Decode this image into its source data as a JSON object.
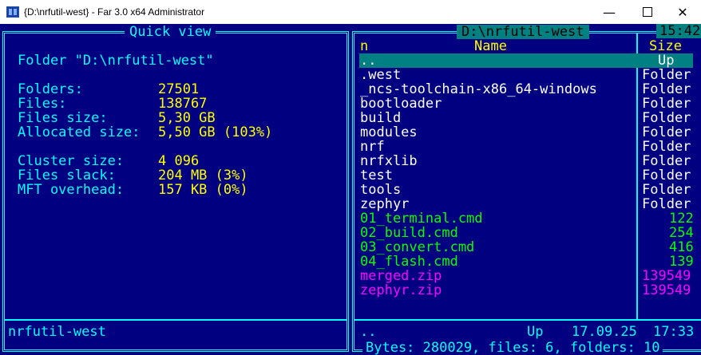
{
  "window": {
    "title": "{D:\\nrfutil-west} - Far 3.0 x64 Administrator",
    "minimize_icon": "minimize-icon",
    "maximize_icon": "maximize-icon",
    "close_icon": "close-icon",
    "app_icon": "far-manager-icon"
  },
  "clock": "15:42",
  "left_panel": {
    "title": "Quick view",
    "folder_line": "Folder \"D:\\nrfutil-west\"",
    "stats": [
      {
        "label": "Folders:",
        "value": "27501"
      },
      {
        "label": "Files:",
        "value": "138767"
      },
      {
        "label": "Files size:",
        "value": "5,30 GB"
      },
      {
        "label": "Allocated size:",
        "value": "5,50 GB (103%)"
      }
    ],
    "stats2": [
      {
        "label": "Cluster size:",
        "value": "4 096"
      },
      {
        "label": "Files slack:",
        "value": "204 MB (3%)"
      },
      {
        "label": "MFT overhead:",
        "value": "157 KB (0%)"
      }
    ],
    "status": "nrfutil-west"
  },
  "right_panel": {
    "title": "D:\\nrfutil-west",
    "col_n": "n",
    "col_name": "Name",
    "col_size": "Size",
    "rows": [
      {
        "name": "..",
        "size": "Up",
        "kind": "up"
      },
      {
        "name": ".west",
        "size": "Folder",
        "kind": "dir"
      },
      {
        "name": "_ncs-toolchain-x86_64-windows",
        "size": "Folder",
        "kind": "dir"
      },
      {
        "name": "bootloader",
        "size": "Folder",
        "kind": "dir"
      },
      {
        "name": "build",
        "size": "Folder",
        "kind": "dir"
      },
      {
        "name": "modules",
        "size": "Folder",
        "kind": "dir"
      },
      {
        "name": "nrf",
        "size": "Folder",
        "kind": "dir"
      },
      {
        "name": "nrfxlib",
        "size": "Folder",
        "kind": "dir"
      },
      {
        "name": "test",
        "size": "Folder",
        "kind": "dir"
      },
      {
        "name": "tools",
        "size": "Folder",
        "kind": "dir"
      },
      {
        "name": "zephyr",
        "size": "Folder",
        "kind": "dir"
      },
      {
        "name": "01_terminal.cmd",
        "size": "122",
        "kind": "cmd"
      },
      {
        "name": "02_build.cmd",
        "size": "254",
        "kind": "cmd"
      },
      {
        "name": "03_convert.cmd",
        "size": "416",
        "kind": "cmd"
      },
      {
        "name": "04_flash.cmd",
        "size": "139",
        "kind": "cmd"
      },
      {
        "name": "merged.zip",
        "size": "139549",
        "kind": "zip"
      },
      {
        "name": "zephyr.zip",
        "size": "139549",
        "kind": "zip"
      }
    ],
    "status_name": "..",
    "status_type": "Up",
    "status_date": "17.09.25",
    "status_time": "17:33",
    "summary": "Bytes: 280029, files: 6, folders: 10"
  },
  "colors": {
    "background": "#000080",
    "frame": "#00ffff",
    "highlight": "#008080",
    "folder_text": "#ffffff",
    "cmd_text": "#00ff00",
    "zip_text": "#ff00ff",
    "value_text": "#ffff00"
  }
}
